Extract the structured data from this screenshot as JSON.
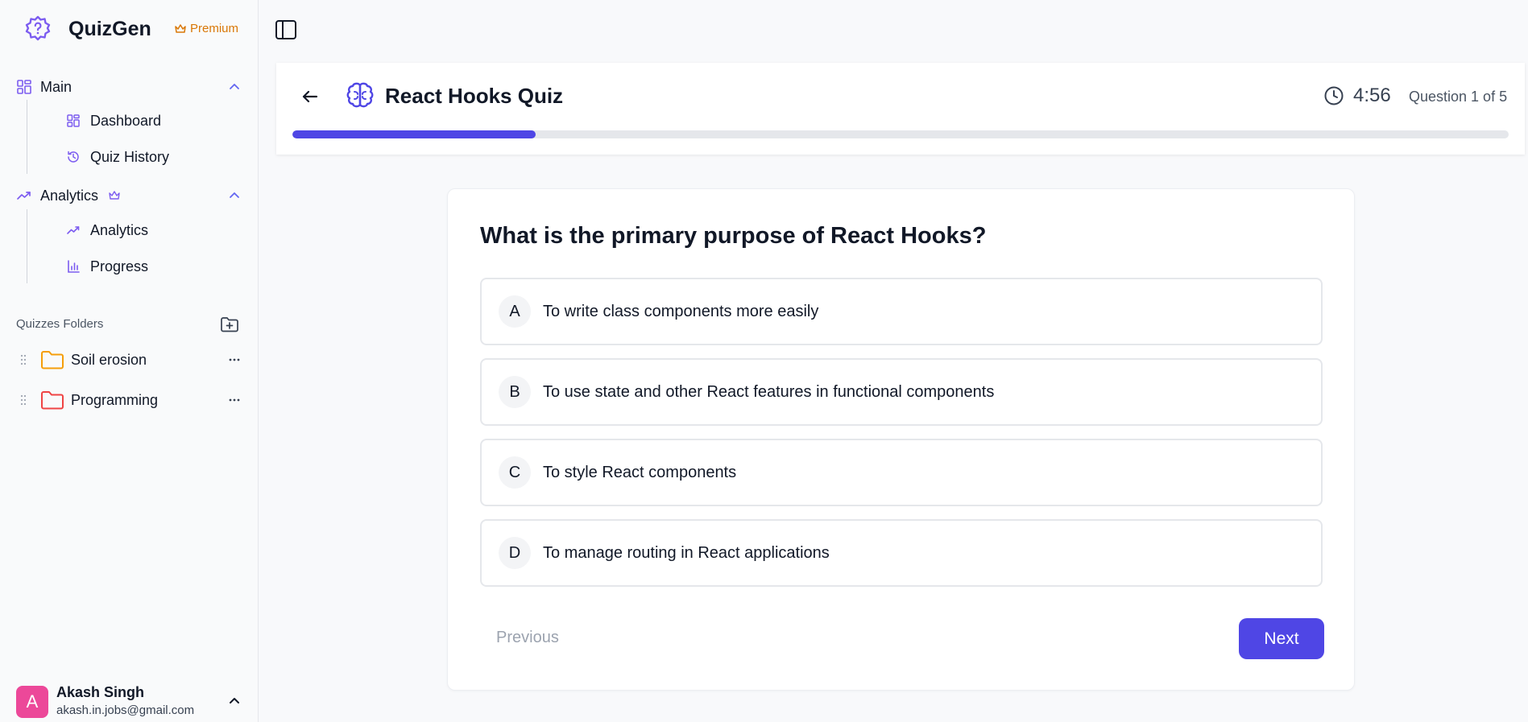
{
  "app": {
    "name": "QuizGen",
    "badge": "Premium",
    "brand_color": "#7c5cf0",
    "accent_color": "#4f46e5"
  },
  "sidebar": {
    "sections": [
      {
        "label": "Main",
        "icon": "grid-icon",
        "items": [
          {
            "label": "Dashboard",
            "icon": "dashboard-icon"
          },
          {
            "label": "Quiz History",
            "icon": "history-icon"
          }
        ]
      },
      {
        "label": "Analytics",
        "icon": "trending-up-icon",
        "premium": true,
        "items": [
          {
            "label": "Analytics",
            "icon": "trending-up-icon"
          },
          {
            "label": "Progress",
            "icon": "bar-chart-icon"
          }
        ]
      }
    ],
    "folders_title": "Quizzes Folders",
    "folders": [
      {
        "name": "Soil erosion",
        "color": "#f59e0b"
      },
      {
        "name": "Programming",
        "color": "#ef4444"
      }
    ],
    "user": {
      "initial": "A",
      "name": "Akash Singh",
      "email": "akash.in.jobs@gmail.com"
    }
  },
  "quiz": {
    "title": "React Hooks Quiz",
    "timer": "4:56",
    "question_counter": "Question 1 of 5",
    "progress_fraction": 0.2,
    "question": "What is the primary purpose of React Hooks?",
    "options": [
      {
        "letter": "A",
        "text": "To write class components more easily"
      },
      {
        "letter": "B",
        "text": "To use state and other React features in functional components"
      },
      {
        "letter": "C",
        "text": "To style React components"
      },
      {
        "letter": "D",
        "text": "To manage routing in React applications"
      }
    ],
    "prev_label": "Previous",
    "next_label": "Next"
  }
}
